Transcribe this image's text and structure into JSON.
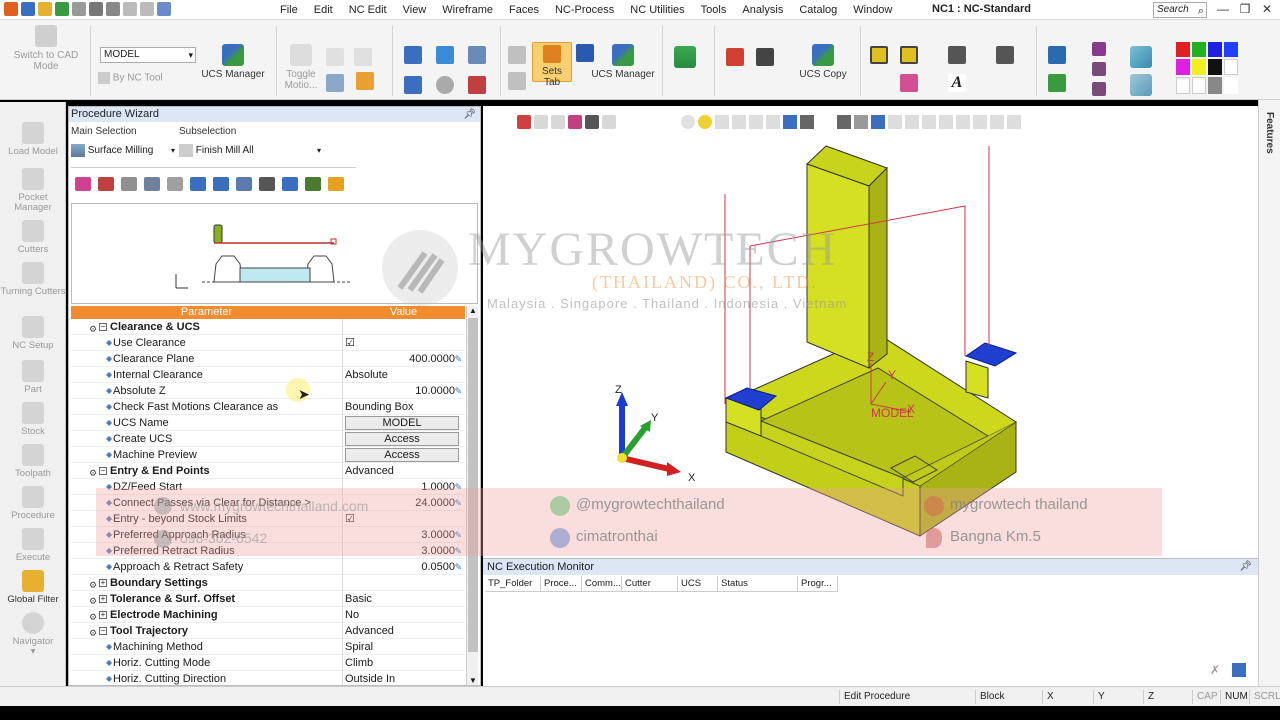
{
  "title_bar": {
    "app_title": "NC1 : NC-Standard",
    "menu": [
      "File",
      "Edit",
      "NC Edit",
      "View",
      "Wireframe",
      "Faces",
      "NC-Process",
      "NC Utilities",
      "Tools",
      "Analysis",
      "Catalog",
      "Window"
    ],
    "search_placeholder": "Search",
    "window_buttons": [
      "—",
      "❐",
      "✕"
    ]
  },
  "ribbon": {
    "switch_to_cad": "Switch to CAD Mode",
    "model_select": "MODEL",
    "by_nc_tool": "By NC Tool",
    "ucs_manager_1": "UCS Manager",
    "toggle_motion": "Toggle Motio...",
    "sets_tab": "Sets Tab",
    "ucs_manager_2": "UCS Manager",
    "ucs_copy": "UCS Copy"
  },
  "left_bar": {
    "items": [
      "Load Model",
      "Pocket Manager",
      "Cutters",
      "Turning Cutters",
      "NC Setup",
      "Part",
      "Stock",
      "Toolpath",
      "Procedure",
      "Execute",
      "Global Filter",
      "Navigator"
    ]
  },
  "wizard": {
    "title": "Procedure Wizard",
    "main_selection_label": "Main Selection",
    "subselection_label": "Subselection",
    "main_selection": "Surface Milling",
    "subselection": "Finish Mill All",
    "col_parameter": "Parameter",
    "col_value": "Value",
    "rows": [
      {
        "type": "group",
        "name": "Clearance & UCS",
        "value": "",
        "open": true
      },
      {
        "type": "check",
        "name": "Use Clearance",
        "value": "☑"
      },
      {
        "type": "num",
        "name": "Clearance Plane",
        "value": "400.0000"
      },
      {
        "type": "text",
        "name": "Internal Clearance",
        "value": "Absolute"
      },
      {
        "type": "num",
        "name": "Absolute Z",
        "value": "10.0000"
      },
      {
        "type": "text",
        "name": "Check Fast Motions Clearance as",
        "value": "Bounding Box"
      },
      {
        "type": "button",
        "name": "UCS Name",
        "value": "MODEL"
      },
      {
        "type": "button",
        "name": "Create UCS",
        "value": "Access"
      },
      {
        "type": "button",
        "name": "Machine Preview",
        "value": "Access"
      },
      {
        "type": "group",
        "name": "Entry & End Points",
        "value": "Advanced",
        "open": true
      },
      {
        "type": "num",
        "name": "DZ/Feed Start",
        "value": "1.0000"
      },
      {
        "type": "num",
        "name": "Connect Passes via Clear for Distance >",
        "value": "24.0000"
      },
      {
        "type": "check",
        "name": "Entry - beyond Stock Limits",
        "value": "☑"
      },
      {
        "type": "num",
        "name": "Preferred Approach Radius",
        "value": "3.0000"
      },
      {
        "type": "num",
        "name": "Preferred Retract Radius",
        "value": "3.0000"
      },
      {
        "type": "num",
        "name": "Approach & Retract Safety",
        "value": "0.0500"
      },
      {
        "type": "group",
        "name": "Boundary Settings",
        "value": "",
        "open": false
      },
      {
        "type": "group",
        "name": "Tolerance & Surf. Offset",
        "value": "Basic",
        "open": false
      },
      {
        "type": "group",
        "name": "Electrode Machining",
        "value": "No",
        "open": false
      },
      {
        "type": "group",
        "name": "Tool Trajectory",
        "value": "Advanced",
        "open": true
      },
      {
        "type": "text",
        "name": "Machining Method",
        "value": "Spiral"
      },
      {
        "type": "text",
        "name": "Horiz. Cutting Mode",
        "value": "Climb"
      },
      {
        "type": "text",
        "name": "Horiz. Cutting Direction",
        "value": "Outside In"
      }
    ]
  },
  "viewport": {
    "axis_labels": {
      "x": "X",
      "y": "Y",
      "z": "Z"
    },
    "model_label": "MODEL",
    "watermark_title": "MYGROWTECH",
    "watermark_sub": "(THAILAND) CO., LTD.",
    "watermark_countries": "Malaysia . Singapore . Thailand . Indonesia . Vietnam",
    "banner": {
      "web": "www.mygrowtechthailand.com",
      "phone": "098-302-6542",
      "line": "@mygrowtechthailand",
      "facebook": "cimatronthai",
      "youtube": "mygrowtech thailand",
      "location": "Bangna Km.5"
    }
  },
  "monitor": {
    "title": "NC Execution Monitor",
    "columns": [
      "TP_Folder",
      "Proce...",
      "Comm...",
      "Cutter",
      "UCS",
      "Status",
      "Progr..."
    ]
  },
  "right_strip": {
    "label": "Features"
  },
  "status_bar": {
    "mode": "Edit Procedure",
    "block": "Block",
    "x": "X",
    "y": "Y",
    "z": "Z",
    "cap": "CAP",
    "num": "NUM",
    "scrl": "SCRL"
  },
  "colors": {
    "model_yellow": "#d4e021",
    "grid_header": "#f28a2e",
    "selection_blue": "#1f3fd0",
    "toolpath_red": "#d2354f"
  }
}
